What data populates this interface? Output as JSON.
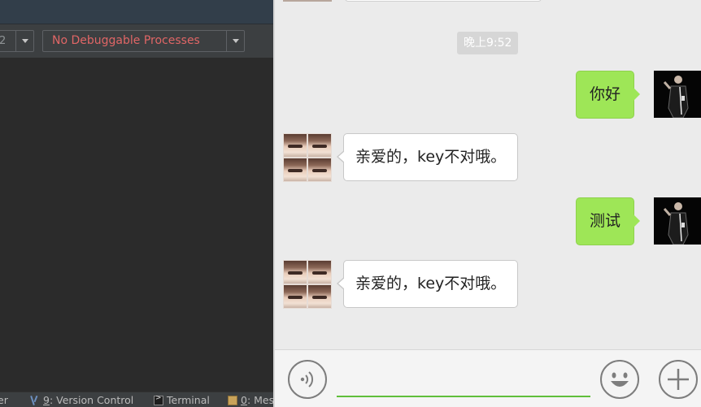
{
  "ide": {
    "device_combo_value": "2",
    "process_combo_value": "No Debuggable Processes",
    "statusbar": {
      "left_cut": "er",
      "version_control_key": "9",
      "version_control_label": ": Version Control",
      "terminal_label": "Terminal",
      "messages_key": "0",
      "messages_label": ": Mes"
    }
  },
  "chat": {
    "timestamp": "晚上9:52",
    "messages": [
      {
        "direction": "out",
        "text": "你好"
      },
      {
        "direction": "in",
        "text": "亲爱的，key不对哦。"
      },
      {
        "direction": "out",
        "text": "测试"
      },
      {
        "direction": "in",
        "text": "亲爱的，key不对哦。"
      }
    ]
  },
  "input_bar": {
    "icons": [
      "voice-icon",
      "emoji-icon",
      "plus-icon"
    ]
  },
  "colors": {
    "outgoing_bubble": "#9ee657",
    "incoming_bubble": "#ffffff",
    "chat_background": "#ebebeb",
    "input_underline": "#5fbf3a",
    "ide_background": "#2b2b2b",
    "process_text": "#e06666"
  }
}
